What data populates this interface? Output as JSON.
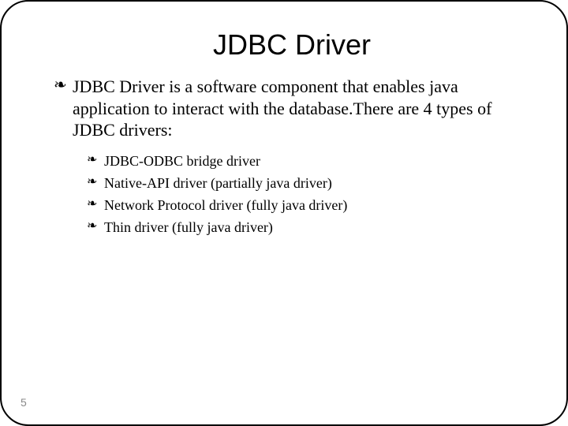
{
  "slide": {
    "title": "JDBC Driver",
    "intro": "JDBC Driver is a software component that enables java application to interact with the database.There are 4 types of JDBC drivers:",
    "subitems": [
      "JDBC-ODBC bridge driver",
      "Native-API driver (partially java driver)",
      "Network Protocol driver (fully java driver)",
      "Thin driver (fully java driver)"
    ],
    "page_number": "5"
  }
}
